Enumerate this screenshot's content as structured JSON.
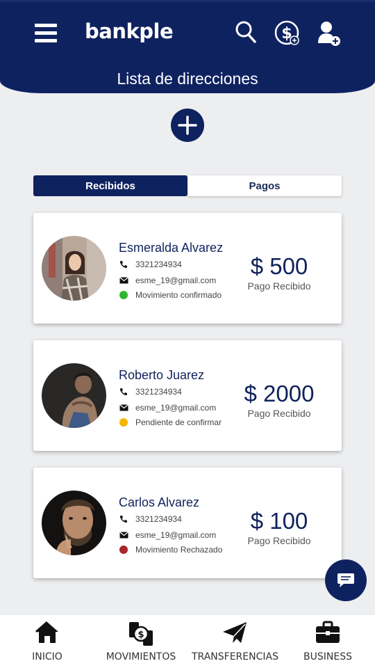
{
  "header": {
    "brand": "bankple",
    "title": "Lista de direcciones",
    "icons": [
      "menu-icon",
      "search-icon",
      "dollar-add-icon",
      "user-add-icon"
    ]
  },
  "tabs": [
    {
      "label": "Recibidos",
      "active": true
    },
    {
      "label": "Pagos",
      "active": false
    }
  ],
  "contacts": [
    {
      "name": "Esmeralda Alvarez",
      "phone": "3321234934",
      "email": "esme_19@gmail.com",
      "status": "Movimiento confirmado",
      "status_color": "#2fb52f",
      "amount": "$ 500",
      "amount_label": "Pago Recibido"
    },
    {
      "name": "Roberto Juarez",
      "phone": "3321234934",
      "email": "esme_19@gmail.com",
      "status": "Pendiente de confirmar",
      "status_color": "#f5b400",
      "amount": "$ 2000",
      "amount_label": "Pago Recibido"
    },
    {
      "name": "Carlos Alvarez",
      "phone": "3321234934",
      "email": "esme_19@gmail.com",
      "status": "Movimiento Rechazado",
      "status_color": "#a8272a",
      "amount": "$ 100",
      "amount_label": "Pago Recibido"
    }
  ],
  "bottom_nav": [
    {
      "label": "INICIO",
      "icon": "home-icon"
    },
    {
      "label": "MOVIMIENTOS",
      "icon": "money-exchange-icon"
    },
    {
      "label": "TRANSFERENCIAS",
      "icon": "paper-plane-icon"
    },
    {
      "label": "BUSINESS",
      "icon": "briefcase-icon"
    }
  ],
  "colors": {
    "primary": "#0f2260",
    "background": "#edeef0"
  }
}
